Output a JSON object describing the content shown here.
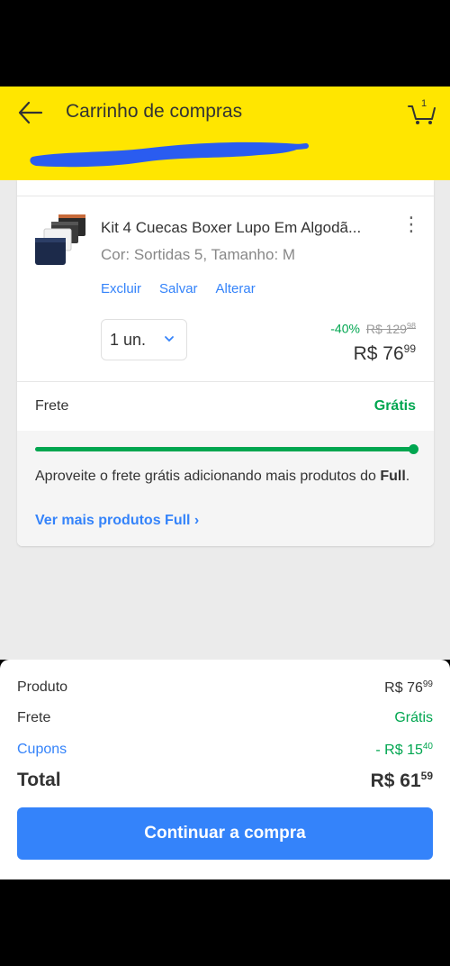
{
  "header": {
    "title": "Carrinho de compras",
    "cart_count": "1",
    "bg_color": "#ffe600"
  },
  "cart_item": {
    "title": "Kit 4 Cuecas Boxer Lupo Em Algodã...",
    "variant": "Cor: Sortidas 5, Tamanho: M",
    "actions": [
      "Excluir",
      "Salvar",
      "Alterar"
    ],
    "quantity": "1 un.",
    "discount_pct": "-40%",
    "old_price": "R$ 129",
    "old_price_cents": "98",
    "price": "R$ 76",
    "price_cents": "99"
  },
  "shipping": {
    "label": "Frete",
    "value": "Grátis",
    "progress_fraction": 1.0,
    "message_pre": "Aproveite o frete grátis adicionando mais produtos do ",
    "message_bold": "Full",
    "message_post": ".",
    "link": "Ver mais produtos Full ›"
  },
  "summary": {
    "produto_label": "Produto",
    "produto_value": "R$ 76",
    "produto_cents": "99",
    "frete_label": "Frete",
    "frete_value": "Grátis",
    "cupons_label": "Cupons",
    "cupons_value": "- R$ 15",
    "cupons_cents": "40",
    "total_label": "Total",
    "total_value": "R$ 61",
    "total_cents": "59",
    "continue_label": "Continuar a compra"
  },
  "colors": {
    "accent_blue": "#3483fa",
    "success_green": "#00a650",
    "yellow": "#ffe600"
  }
}
